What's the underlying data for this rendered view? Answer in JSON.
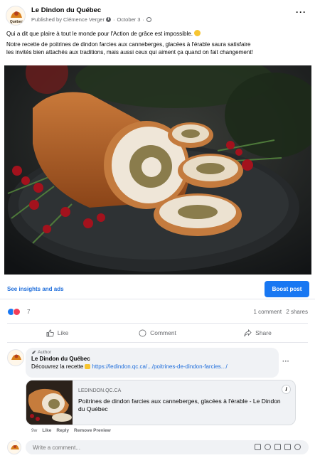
{
  "post": {
    "page_name": "Le Dindon du Québec",
    "avatar_text": "Québec",
    "published_by": "Published by Clémence Verger",
    "date": "October 3",
    "more": "···",
    "text_line1": "Qui a dit que plaire à tout le monde pour l'Action de grâce est impossible.",
    "text_line2": "Notre recette de poitrines de dindon farcies aux canneberges, glacées à l'érable saura satisfaire",
    "text_line3": "les invités bien attachés aux traditions, mais aussi ceux qui aiment ça quand on fait changement!"
  },
  "insights": {
    "link_label": "See insights and ads",
    "boost_label": "Boost post"
  },
  "reactions": {
    "count": "7",
    "comments": "1 comment",
    "shares": "2 shares"
  },
  "actions": {
    "like": "Like",
    "comment": "Comment",
    "share": "Share"
  },
  "comment": {
    "author_tag": "Author",
    "author": "Le Dindon du Québec",
    "text": "Découvrez la recette",
    "link": "https://ledindon.qc.ca/.../poitrines-de-dindon-farcies.../",
    "more": "···",
    "time": "9w",
    "like": "Like",
    "reply": "Reply",
    "remove_preview": "Remove Preview"
  },
  "link_preview": {
    "domain": "LEDINDON.QC.CA",
    "title": "Poitrines de dindon farcies aux canneberges, glacées à l'érable - Le Dindon du Québec",
    "info": "i"
  },
  "write_comment": {
    "placeholder": "Write a comment..."
  },
  "colors": {
    "accent": "#1877f2",
    "link": "#216fdb",
    "muted": "#65676b",
    "bubble": "#f0f2f5"
  }
}
